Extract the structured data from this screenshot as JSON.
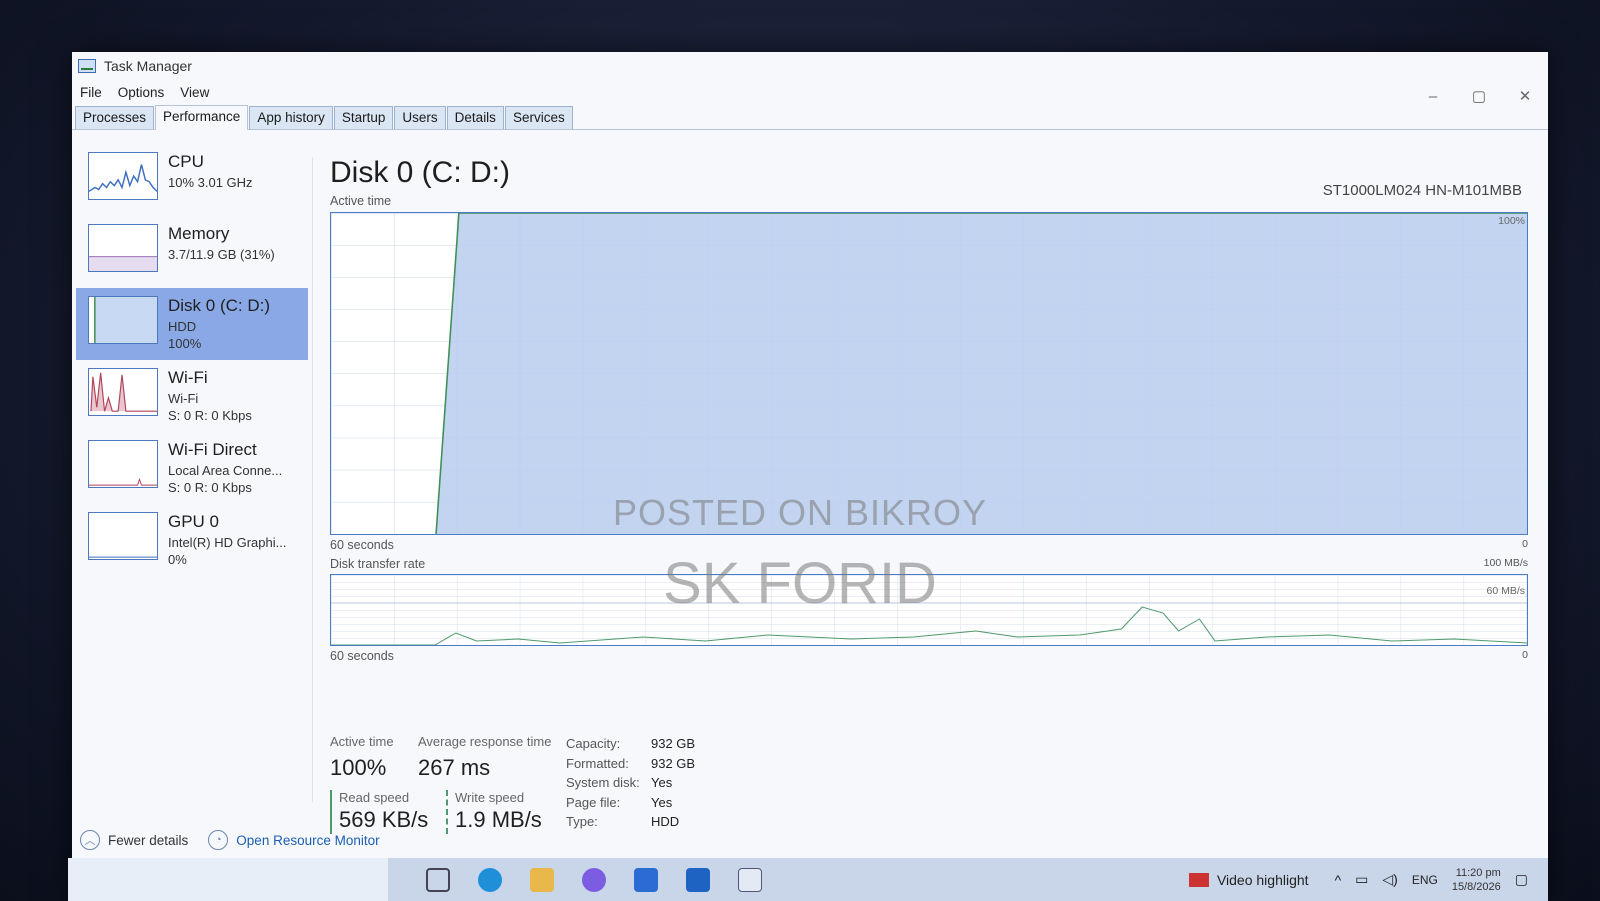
{
  "window": {
    "title": "Task Manager",
    "controls": [
      "–",
      "▢",
      "✕"
    ]
  },
  "menu": [
    "File",
    "Options",
    "View"
  ],
  "tabs": [
    {
      "label": "Processes"
    },
    {
      "label": "Performance"
    },
    {
      "label": "App history"
    },
    {
      "label": "Startup"
    },
    {
      "label": "Users"
    },
    {
      "label": "Details"
    },
    {
      "label": "Services"
    }
  ],
  "sidebar": {
    "items": [
      {
        "name": "CPU",
        "line1": "10% 3.01 GHz",
        "line2": ""
      },
      {
        "name": "Memory",
        "line1": "3.7/11.9 GB (31%)",
        "line2": ""
      },
      {
        "name": "Disk 0 (C: D:)",
        "line1": "HDD",
        "line2": "100%"
      },
      {
        "name": "Wi-Fi",
        "line1": "Wi-Fi",
        "line2": "S: 0 R: 0 Kbps"
      },
      {
        "name": "Wi-Fi Direct",
        "line1": "Local Area Conne...",
        "line2": "S: 0 R: 0 Kbps"
      },
      {
        "name": "GPU 0",
        "line1": "Intel(R) HD Graphi...",
        "line2": "0%"
      }
    ]
  },
  "main": {
    "title": "Disk 0 (C: D:)",
    "model": "ST1000LM024 HN-M101MBB",
    "active_chart": {
      "label": "Active time",
      "max": "100%",
      "xlabel": "60 seconds",
      "min": "0"
    },
    "transfer_chart": {
      "label": "Disk transfer rate",
      "max": "100 MB/s",
      "mid": "60 MB/s",
      "xlabel": "60 seconds",
      "min": "0"
    }
  },
  "stats": {
    "active_time_label": "Active time",
    "active_time_value": "100%",
    "avg_response_label": "Average response time",
    "avg_response_value": "267 ms",
    "read_speed_label": "Read speed",
    "read_speed_value": "569 KB/s",
    "write_speed_label": "Write speed",
    "write_speed_value": "1.9 MB/s",
    "properties": [
      {
        "k": "Capacity:",
        "v": "932 GB"
      },
      {
        "k": "Formatted:",
        "v": "932 GB"
      },
      {
        "k": "System disk:",
        "v": "Yes"
      },
      {
        "k": "Page file:",
        "v": "Yes"
      },
      {
        "k": "Type:",
        "v": "HDD"
      }
    ]
  },
  "footer": {
    "fewer_details": "Fewer details",
    "resource_monitor": "Open Resource Monitor"
  },
  "watermarks": {
    "line1": "POSTED ON BIKROY",
    "line2": "SK FORID"
  },
  "taskbar": {
    "video_highlight": "Video highlight",
    "lang": "ENG",
    "time": "11:20 pm",
    "date": "15/8/2026"
  },
  "colors": {
    "accent": "#4a7bc7",
    "selected": "#8aa8e6",
    "fill": "#b9cdef"
  }
}
